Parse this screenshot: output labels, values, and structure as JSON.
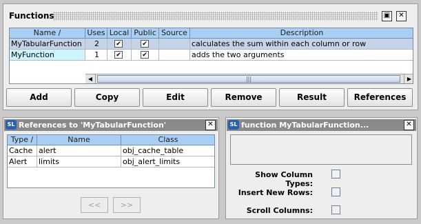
{
  "functions_panel": {
    "title": "Functions",
    "columns": [
      "Name /",
      "Uses",
      "Local",
      "Public",
      "Source",
      "Description"
    ],
    "rows": [
      {
        "name": "MyTabularFunction",
        "uses": "2",
        "local": true,
        "public": true,
        "source": "",
        "description": "calculates the sum within each column or row"
      },
      {
        "name": "MyFunction",
        "uses": "1",
        "local": true,
        "public": true,
        "source": "",
        "description": "adds the two arguments"
      }
    ],
    "buttons": [
      "Add",
      "Copy",
      "Edit",
      "Remove",
      "Result",
      "References"
    ]
  },
  "references_panel": {
    "title": "References to 'MyTabularFunction'",
    "columns": [
      "Type /",
      "Name",
      "Class"
    ],
    "rows": [
      {
        "type": "Cache",
        "name": "alert",
        "class": "obj_cache_table"
      },
      {
        "type": "Alert",
        "name": "limits",
        "class": "obj_alert_limits"
      }
    ],
    "prev": "<<",
    "next": ">>"
  },
  "function_panel": {
    "title": "function MyTabularFunction...",
    "options": [
      "Show Column Types:",
      "Insert New Rows:",
      "Scroll Columns:"
    ]
  },
  "icons": {
    "logo": "SL",
    "check": "✔",
    "close": "✕"
  },
  "colors": {
    "header": "#a9cff4",
    "selected_row": "#c4d3e8",
    "cyan_cell": "#ccf5ff"
  }
}
